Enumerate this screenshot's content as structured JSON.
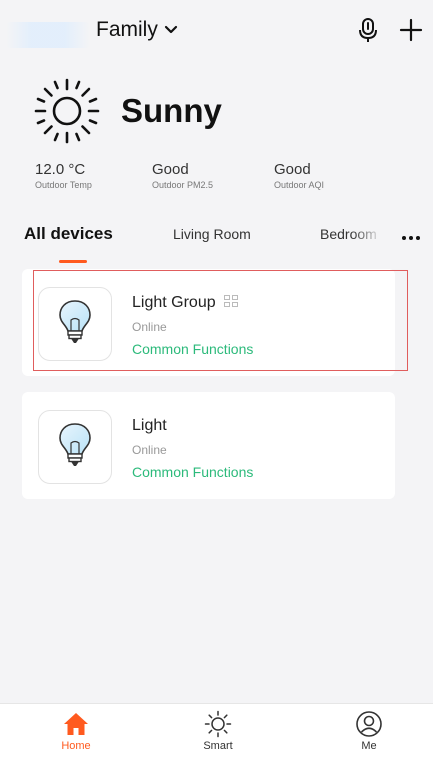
{
  "header": {
    "home_name": "Family",
    "icons": {
      "dropdown": "chevron-down-icon",
      "voice": "microphone-icon",
      "add": "plus-icon"
    }
  },
  "weather": {
    "condition": "Sunny",
    "icon": "sun-icon",
    "stats": [
      {
        "value": "12.0 °C",
        "label": "Outdoor Temp"
      },
      {
        "value": "Good",
        "label": "Outdoor PM2.5"
      },
      {
        "value": "Good",
        "label": "Outdoor AQI"
      }
    ]
  },
  "tabs": {
    "items": [
      {
        "label": "All devices",
        "active": true
      },
      {
        "label": "Living Room",
        "active": false
      },
      {
        "label": "Bedroom",
        "active": false
      }
    ],
    "more_icon": "more-horizontal-icon"
  },
  "devices": [
    {
      "name": "Light Group",
      "status": "Online",
      "action": "Common Functions",
      "icon": "light-bulb-icon",
      "badge_icon": "group-icon"
    },
    {
      "name": "Light",
      "status": "Online",
      "action": "Common Functions",
      "icon": "light-bulb-icon"
    }
  ],
  "bottom_nav": {
    "items": [
      {
        "label": "Home",
        "icon": "home-icon",
        "active": true
      },
      {
        "label": "Smart",
        "icon": "sun-outline-icon",
        "active": false
      },
      {
        "label": "Me",
        "icon": "user-icon",
        "active": false
      }
    ]
  },
  "colors": {
    "accent": "#ff5a1f",
    "function_link": "#2cba7b",
    "highlight_border": "#e05d5d",
    "background": "#f4f4f6"
  }
}
